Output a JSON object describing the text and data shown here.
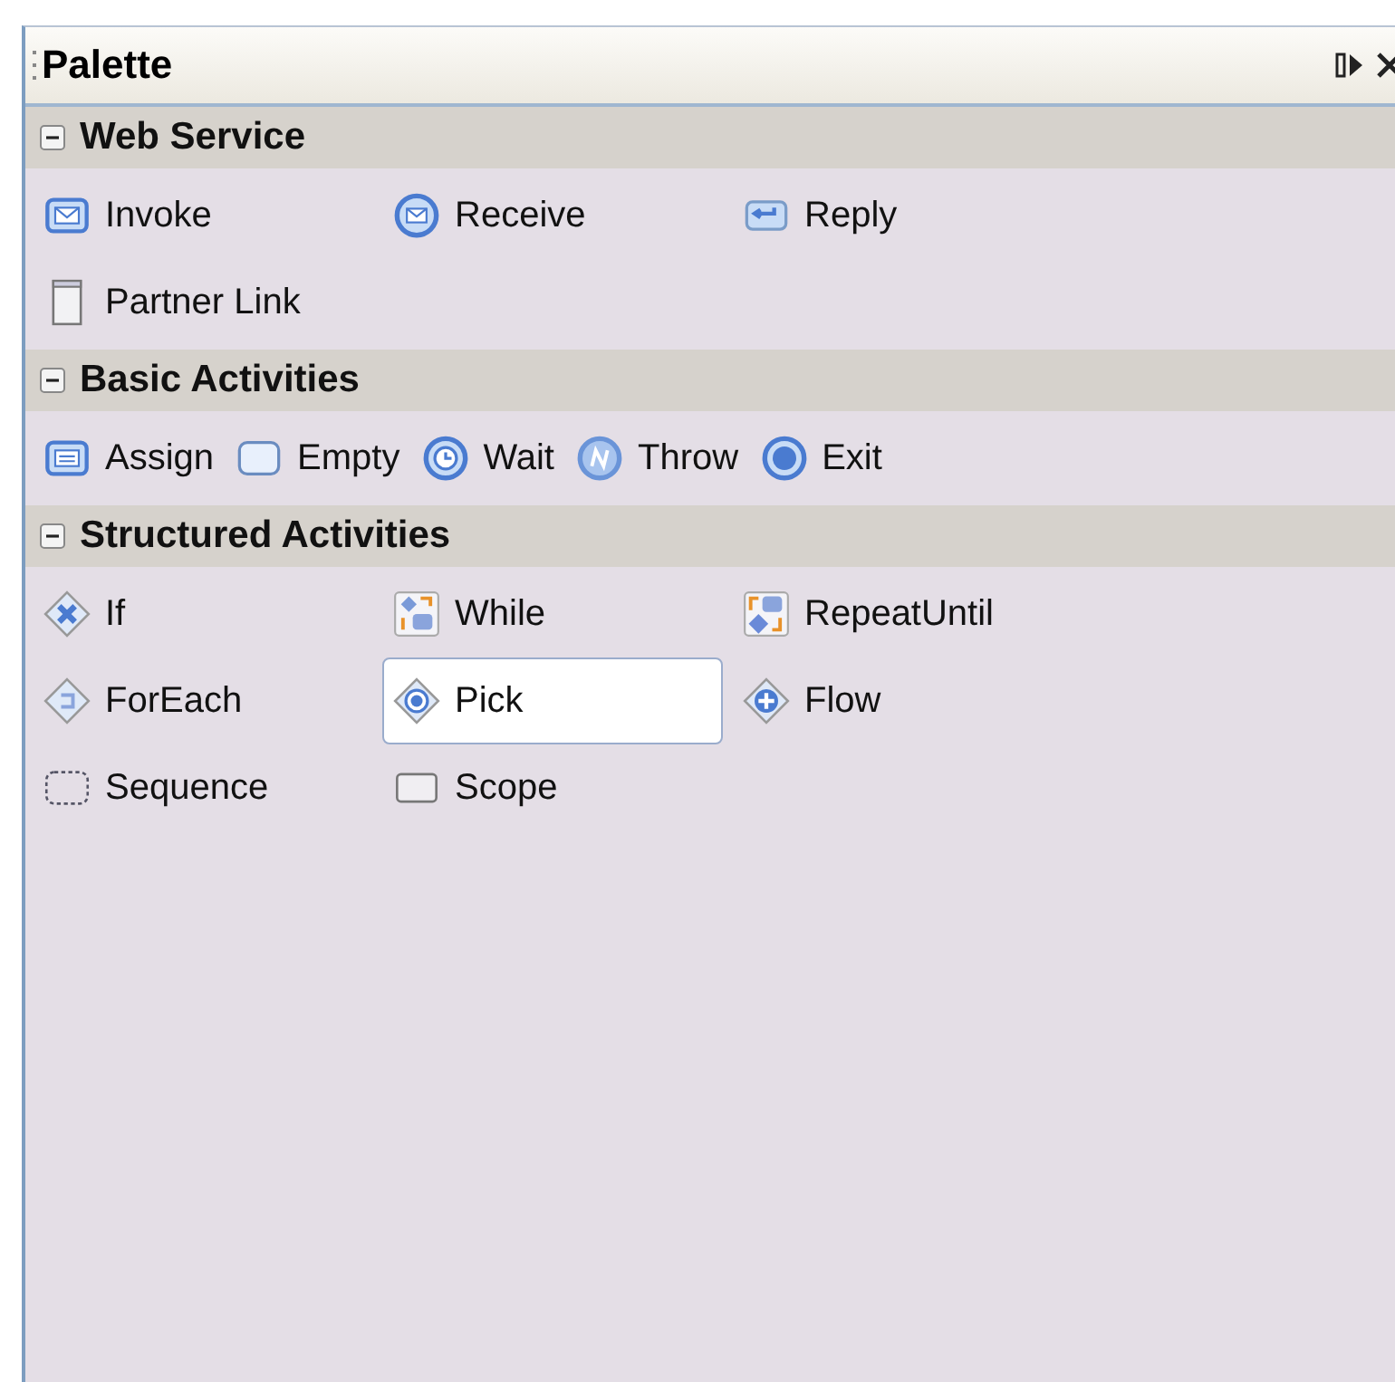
{
  "window": {
    "title": "Palette"
  },
  "sections": [
    {
      "title": "Web Service",
      "expanded": true,
      "kind": "columns",
      "items": [
        {
          "label": "Invoke",
          "kind": "envelope-square",
          "selected": false
        },
        {
          "label": "Receive",
          "kind": "envelope-circle",
          "selected": false
        },
        {
          "label": "Reply",
          "kind": "return",
          "selected": false
        },
        {
          "label": "Partner Link",
          "kind": "page",
          "selected": false
        }
      ]
    },
    {
      "title": "Basic Activities",
      "expanded": true,
      "kind": "compact",
      "items": [
        {
          "label": "Assign",
          "kind": "lines",
          "selected": false
        },
        {
          "label": "Empty",
          "kind": "empty",
          "selected": false
        },
        {
          "label": "Wait",
          "kind": "clock",
          "selected": false
        },
        {
          "label": "Throw",
          "kind": "throw",
          "selected": false
        },
        {
          "label": "Exit",
          "kind": "dot",
          "selected": false
        }
      ]
    },
    {
      "title": "Structured Activities",
      "expanded": true,
      "kind": "columns",
      "items": [
        {
          "label": "If",
          "kind": "diamond-x",
          "selected": false
        },
        {
          "label": "While",
          "kind": "while",
          "selected": false
        },
        {
          "label": "RepeatUntil",
          "kind": "repeat",
          "selected": false
        },
        {
          "label": "ForEach",
          "kind": "diamond-loop",
          "selected": false
        },
        {
          "label": "Pick",
          "kind": "diamond-target",
          "selected": true
        },
        {
          "label": "Flow",
          "kind": "diamond-plus",
          "selected": false
        },
        {
          "label": "Sequence",
          "kind": "dashed",
          "selected": false
        },
        {
          "label": "Scope",
          "kind": "square",
          "selected": false
        }
      ]
    }
  ]
}
